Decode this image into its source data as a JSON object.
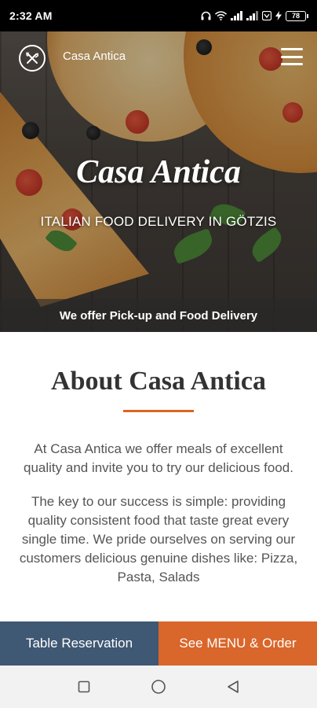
{
  "status_bar": {
    "time": "2:32 AM",
    "battery_level": "78",
    "icons": [
      "headphones-icon",
      "wifi-icon",
      "signal-icon",
      "signal-icon",
      "volte-icon",
      "charging-icon",
      "battery-icon"
    ]
  },
  "header": {
    "logo_icon": "fork-knife-icon",
    "brand_name": "Casa Antica",
    "menu_icon": "hamburger-menu-icon"
  },
  "hero": {
    "title": "Casa Antica",
    "subtitle": "ITALIAN FOOD DELIVERY IN GÖTZIS",
    "banner": "We offer Pick-up and Food Delivery"
  },
  "about": {
    "title": "About Casa Antica",
    "accent_color": "#d9661f",
    "paragraph_1": "At Casa Antica we offer meals of excellent quality and invite you to try our delicious food.",
    "paragraph_2": "The key to our success is simple: providing quality consistent food that taste great every single time. We pride ourselves on serving our customers delicious genuine dishes like: Pizza, Pasta, Salads"
  },
  "cta": {
    "reservation_label": "Table Reservation",
    "reservation_color": "#3f5873",
    "menu_label": "See MENU & Order",
    "menu_color": "#d9662a"
  },
  "nav_bar": {
    "buttons": [
      "recents-square-icon",
      "home-circle-icon",
      "back-triangle-icon"
    ]
  }
}
